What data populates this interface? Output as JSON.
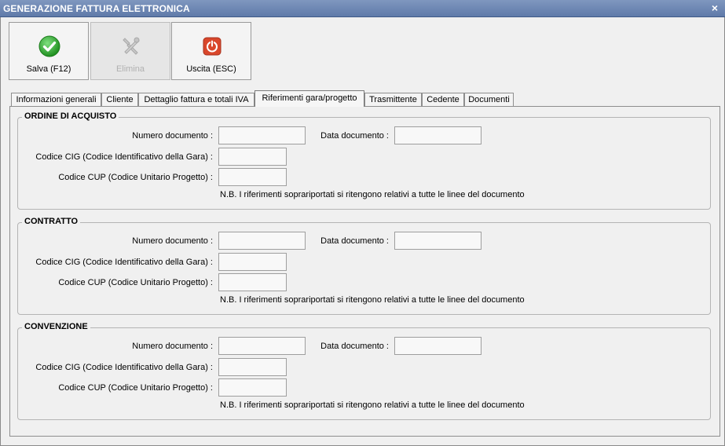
{
  "window": {
    "title": "GENERAZIONE FATTURA ELETTRONICA",
    "close_glyph": "×"
  },
  "toolbar": {
    "buttons": [
      {
        "label": "Salva (F12)",
        "icon": "check-icon",
        "enabled": true
      },
      {
        "label": "Elimina",
        "icon": "delete-tools-icon",
        "enabled": false
      },
      {
        "label": "Uscita (ESC)",
        "icon": "power-icon",
        "enabled": true
      }
    ]
  },
  "tabs": [
    {
      "label": "Informazioni generali"
    },
    {
      "label": "Cliente"
    },
    {
      "label": "Dettaglio fattura e totali IVA"
    },
    {
      "label": "Riferimenti gara/progetto",
      "active": true
    },
    {
      "label": "Trasmittente"
    },
    {
      "label": "Cedente"
    },
    {
      "label": "Documenti"
    }
  ],
  "labels": {
    "numero_documento": "Numero documento :",
    "data_documento": "Data documento :",
    "codice_cig": "Codice CIG (Codice Identificativo della Gara) :",
    "codice_cup": "Codice CUP (Codice Unitario Progetto) :",
    "note": "N.B. I riferimenti soprariportati si ritengono relativi a tutte le linee del documento"
  },
  "groups": [
    {
      "title": "ORDINE DI ACQUISTO",
      "numero_documento": "",
      "data_documento": "",
      "codice_cig": "",
      "codice_cup": ""
    },
    {
      "title": "CONTRATTO",
      "numero_documento": "",
      "data_documento": "",
      "codice_cig": "",
      "codice_cup": ""
    },
    {
      "title": "CONVENZIONE",
      "numero_documento": "",
      "data_documento": "",
      "codice_cig": "",
      "codice_cup": ""
    }
  ],
  "colors": {
    "titlebar": "#6a84b2",
    "ok_green": "#2fa52f",
    "exit_red": "#d9472b"
  }
}
